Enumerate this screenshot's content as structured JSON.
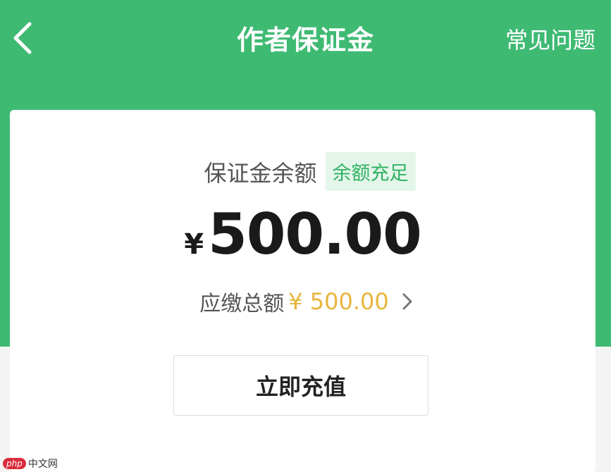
{
  "header": {
    "back_icon": "chevron-left-icon",
    "title": "作者保证金",
    "faq_label": "常见问题",
    "background_color": "#3fba73"
  },
  "deposit_card": {
    "balance_label": "保证金余额",
    "status_badge": "余额充足",
    "currency_symbol": "¥",
    "balance_amount": "500.00",
    "due_label": "应缴总额",
    "due_amount": "¥ 500.00",
    "due_chevron_icon": "chevron-right-icon",
    "recharge_button_label": "立即充值"
  },
  "colors": {
    "accent_green": "#3fba73",
    "status_green": "#2fb262",
    "due_amount_gold": "#e7b53c"
  },
  "watermark": {
    "logo_text": "php",
    "site_text": "中文网"
  }
}
